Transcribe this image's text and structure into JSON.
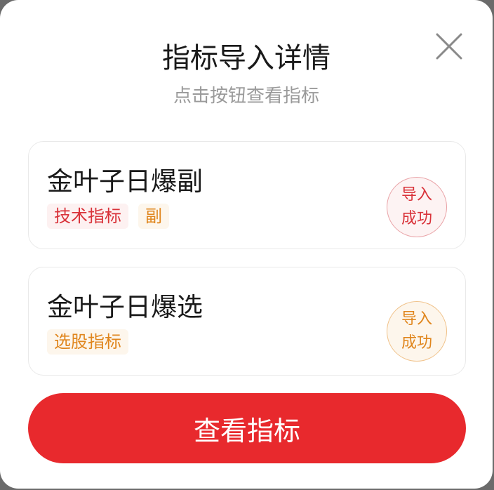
{
  "dialog": {
    "title": "指标导入详情",
    "subtitle": "点击按钮查看指标"
  },
  "cards": [
    {
      "name": "金叶子日爆副",
      "tags": [
        "技术指标",
        "副"
      ],
      "status_line1": "导入",
      "status_line2": "成功"
    },
    {
      "name": "金叶子日爆选",
      "tags": [
        "选股指标"
      ],
      "status_line1": "导入",
      "status_line2": "成功"
    }
  ],
  "button": {
    "label": "查看指标"
  },
  "colors": {
    "accent_red": "#e8292d",
    "tag_red": "#d9333a",
    "tag_orange": "#e0861d",
    "subtitle_gray": "#9a9a9a"
  },
  "icons": {
    "close": "close-icon"
  }
}
